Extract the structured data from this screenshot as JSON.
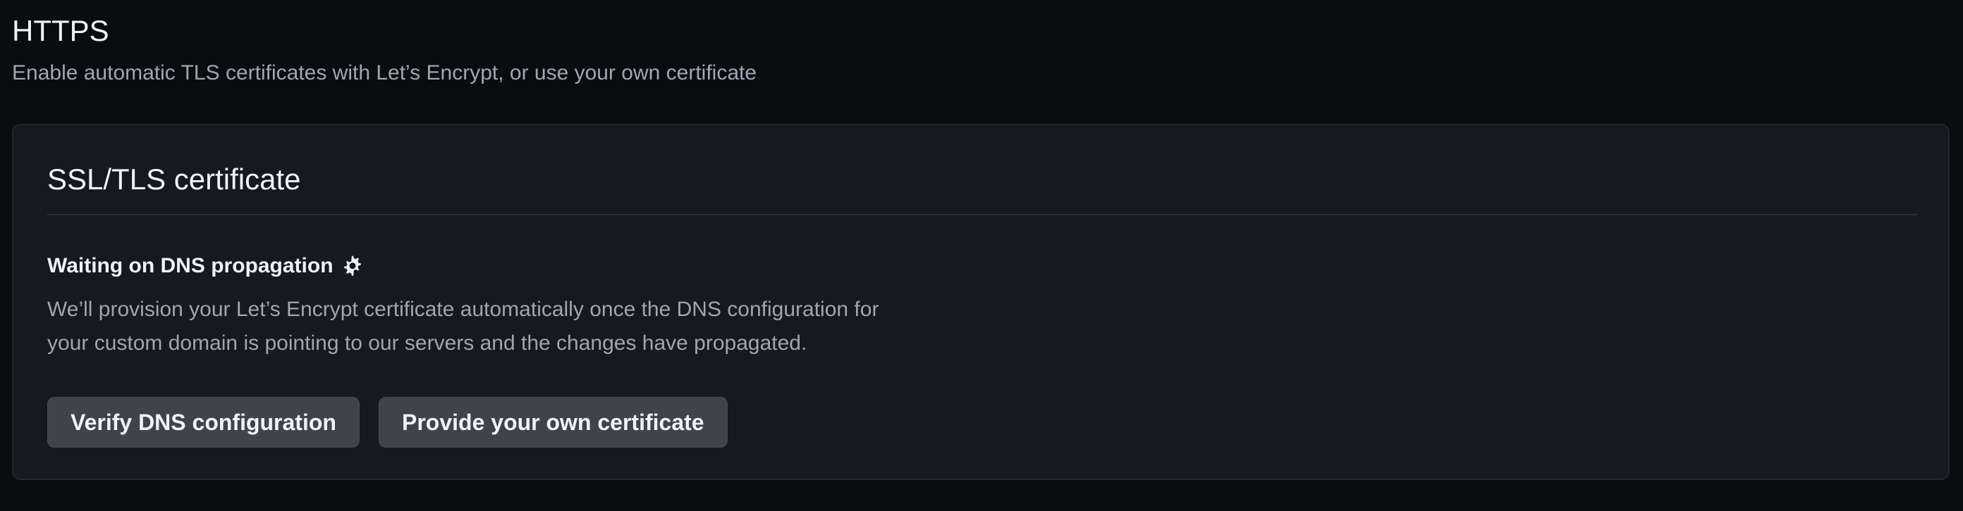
{
  "header": {
    "title": "HTTPS",
    "subtitle": "Enable automatic TLS certificates with Let’s Encrypt, or use your own certificate"
  },
  "certificate_card": {
    "title": "SSL/TLS certificate",
    "status": {
      "heading": "Waiting on DNS propagation",
      "icon": "gear-icon",
      "description_line_1": "We’ll provision your Let’s Encrypt certificate automatically once the DNS configuration for",
      "description_line_2": "your custom domain is pointing to our servers and the changes have propagated."
    },
    "actions": {
      "verify_label": "Verify DNS configuration",
      "own_certificate_label": "Provide your own certificate"
    }
  },
  "colors": {
    "page_background": "#0a0c10",
    "card_background": "#151920",
    "button_background": "#3d444d",
    "primary_text": "#f0f3f6",
    "secondary_text": "#9ea7b3"
  }
}
